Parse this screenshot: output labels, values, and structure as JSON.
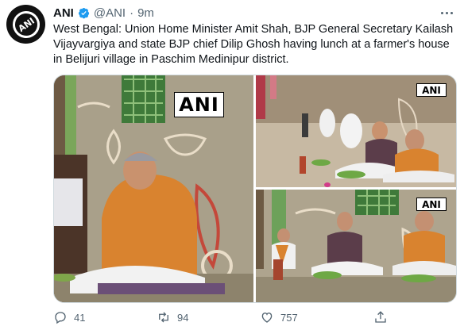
{
  "author": {
    "name": "ANI",
    "handle": "@ANI",
    "separator": "·",
    "time": "9m",
    "avatar_text": "ANI",
    "verified": true
  },
  "tweet": {
    "text": "West Bengal: Union Home Minister Amit Shah, BJP General Secretary Kailash Vijayvargiya and state BJP chief Dilip Ghosh having lunch at a farmer's house in Belijuri village in Paschim Medinipur district."
  },
  "media": {
    "watermark": "ANI",
    "photos": [
      {
        "label": "ANI"
      },
      {
        "label": "ANI"
      },
      {
        "label": "ANI"
      }
    ]
  },
  "actions": {
    "replies": "41",
    "retweets": "94",
    "likes": "757"
  },
  "colors": {
    "text": "#0f1419",
    "muted": "#536471",
    "verified": "#1d9bf0",
    "border": "#cfd9de"
  },
  "icons": [
    "verified-badge-icon",
    "more-options-icon",
    "reply-icon",
    "retweet-icon",
    "like-icon",
    "share-icon"
  ]
}
